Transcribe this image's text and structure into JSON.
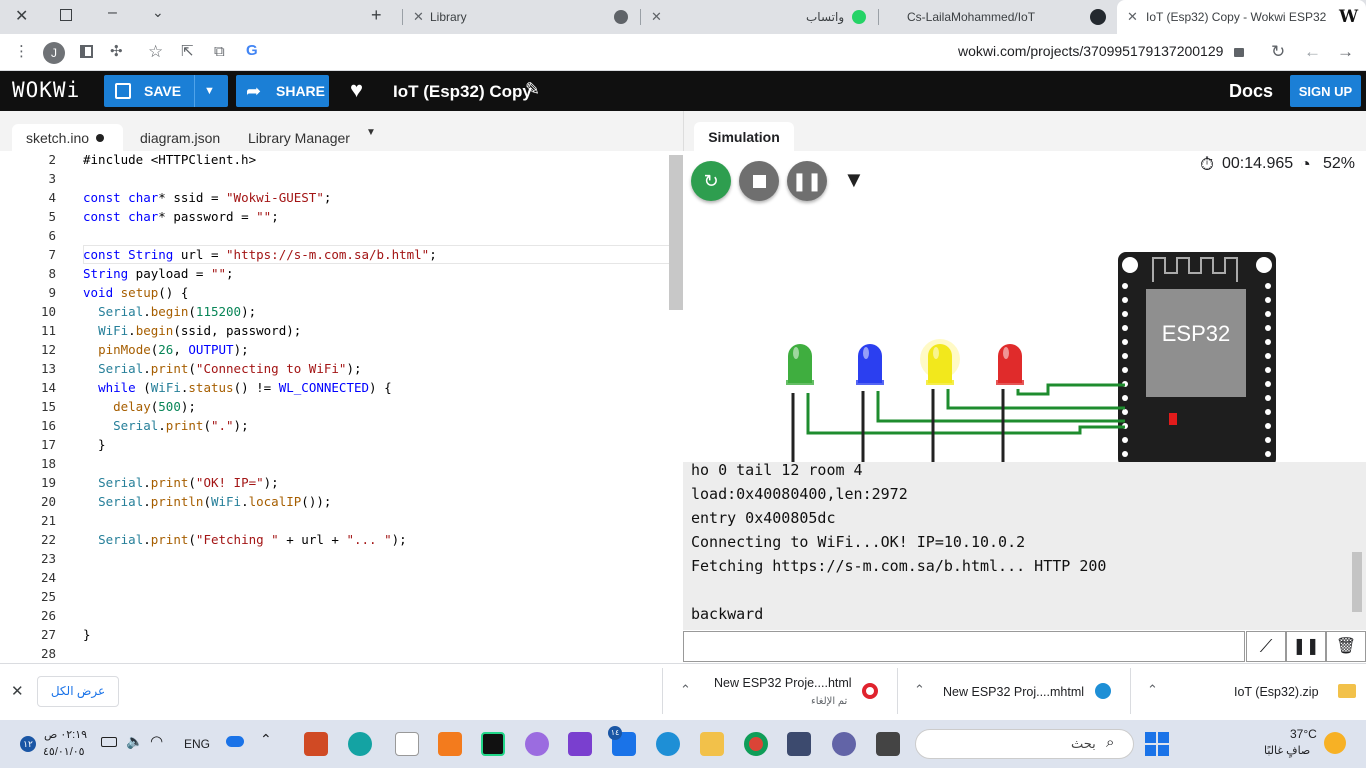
{
  "browser": {
    "tabs": [
      {
        "title": "Library"
      },
      {
        "title": "واتساب"
      },
      {
        "title": "Cs-LailaMohammed/IoT"
      },
      {
        "title": "IoT (Esp32) Copy - Wokwi ESP32"
      }
    ],
    "profile_initial": "J",
    "url": "wokwi.com/projects/370995179137200129"
  },
  "wokwi": {
    "logo": "WOKWi",
    "save_label": "SAVE",
    "share_label": "SHARE",
    "project_title": "IoT (Esp32) Copy",
    "docs_label": "Docs",
    "signup_label": "SIGN UP"
  },
  "editor": {
    "tabs": [
      "sketch.ino",
      "diagram.json",
      "Library Manager"
    ],
    "line_numbers": [
      "2",
      "3",
      "4",
      "5",
      "6",
      "7",
      "8",
      "9",
      "10",
      "11",
      "12",
      "13",
      "14",
      "15",
      "16",
      "17",
      "18",
      "19",
      "20",
      "21",
      "22",
      "23",
      "24",
      "25",
      "26",
      "27",
      "28"
    ],
    "lines": [
      "#include <HTTPClient.h>",
      "",
      "const char* ssid = \"Wokwi-GUEST\";",
      "const char* password = \"\";",
      "",
      "const String url = \"https://s-m.com.sa/b.html\";",
      "String payload = \"\";",
      "void setup() {",
      "  Serial.begin(115200);",
      "  WiFi.begin(ssid, password);",
      "  pinMode(26, OUTPUT);",
      "  Serial.print(\"Connecting to WiFi\");",
      "  while (WiFi.status() != WL_CONNECTED) {",
      "    delay(500);",
      "    Serial.print(\".\");",
      "  }",
      "",
      "  Serial.print(\"OK! IP=\");",
      "  Serial.println(WiFi.localIP());",
      "",
      "  Serial.print(\"Fetching \" + url + \"... \");",
      "",
      "",
      "",
      "",
      "}",
      ""
    ]
  },
  "simulation": {
    "tab_label": "Simulation",
    "timer": "00:14.965",
    "speed": "52%",
    "chip_label": "ESP32",
    "led_colors": [
      "#3fae3f",
      "#2b3ff0",
      "#f2e81c",
      "#e02b2b"
    ],
    "serial_lines": [
      "ho 0 tail 12 room 4",
      "load:0x40080400,len:2972",
      "entry 0x400805dc",
      "Connecting to WiFi...OK! IP=10.10.0.2",
      "Fetching https://s-m.com.sa/b.html... HTTP 200",
      "",
      "backward"
    ]
  },
  "downloads": {
    "show_all": "عرض الكل",
    "items": [
      {
        "name": "New ESP32 Proje....html",
        "status": "تم الإلغاء"
      },
      {
        "name": "New ESP32 Proj....mhtml",
        "status": ""
      },
      {
        "name": "IoT (Esp32).zip",
        "status": ""
      }
    ]
  },
  "taskbar": {
    "time": "٠٢:١٩ ص",
    "date": "٤٥/٠١/٠٥",
    "notif_count": "١٢",
    "lang": "ENG",
    "search_placeholder": "بحث",
    "weather_temp": "37°C",
    "weather_desc": "صافٍ غالبًا",
    "mail_badge": "١٤"
  }
}
